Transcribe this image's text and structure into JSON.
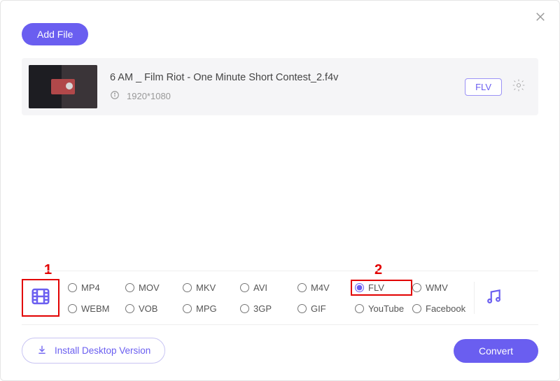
{
  "header": {
    "add_file_label": "Add File"
  },
  "file": {
    "title": "6 AM _ Film Riot - One Minute Short Contest_2.f4v",
    "resolution": "1920*1080",
    "format_chip": "FLV"
  },
  "annotations": {
    "one": "1",
    "two": "2"
  },
  "formats": {
    "row1": [
      "MP4",
      "MOV",
      "MKV",
      "AVI",
      "M4V",
      "FLV",
      "WMV"
    ],
    "row2": [
      "WEBM",
      "VOB",
      "MPG",
      "3GP",
      "GIF",
      "YouTube",
      "Facebook"
    ],
    "selected": "FLV"
  },
  "footer": {
    "install_label": "Install Desktop Version",
    "convert_label": "Convert"
  }
}
